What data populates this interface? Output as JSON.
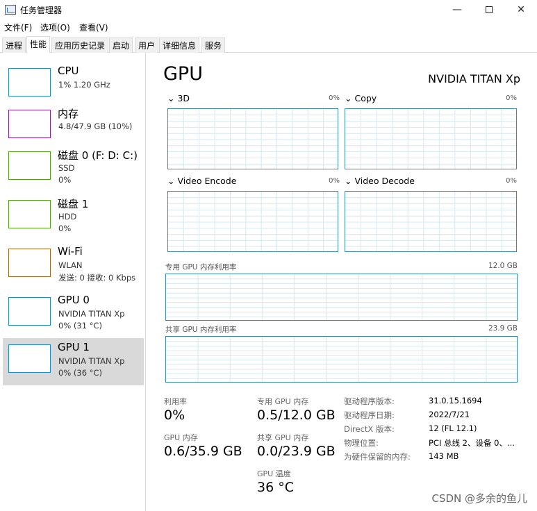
{
  "window": {
    "title": "任务管理器",
    "min": "—",
    "close": "✕"
  },
  "menu": [
    "文件(F)",
    "选项(O)",
    "查看(V)"
  ],
  "tabs": [
    "进程",
    "性能",
    "应用历史记录",
    "启动",
    "用户",
    "详细信息",
    "服务"
  ],
  "active_tab": "性能",
  "sidebar": [
    {
      "title": "CPU",
      "sub": [
        "1% 1.20 GHz"
      ],
      "color": "#1f8bcb"
    },
    {
      "title": "内存",
      "sub": [
        "4.8/47.9 GB (10%)"
      ],
      "color": "#8b1fb0"
    },
    {
      "title": "磁盘 0 (F: D: C:)",
      "sub": [
        "SSD",
        "0%"
      ],
      "color": "#4da516"
    },
    {
      "title": "磁盘 1",
      "sub": [
        "HDD",
        "0%"
      ],
      "color": "#4da516"
    },
    {
      "title": "Wi-Fi",
      "sub": [
        "WLAN",
        "发送: 0 接收: 0 Kbps"
      ],
      "color": "#a7651e"
    },
    {
      "title": "GPU 0",
      "sub": [
        "NVIDIA TITAN Xp",
        "0% (31 °C)"
      ],
      "color": "#1f8bcb"
    },
    {
      "title": "GPU 1",
      "sub": [
        "NVIDIA TITAN Xp",
        "0% (36 °C)"
      ],
      "color": "#1f8bcb",
      "selected": true
    }
  ],
  "main": {
    "title": "GPU",
    "gpu_name": "NVIDIA TITAN Xp",
    "engines": [
      {
        "label": "3D",
        "pct": "0%"
      },
      {
        "label": "Copy",
        "pct": "0%"
      },
      {
        "label": "Video Encode",
        "pct": "0%"
      },
      {
        "label": "Video Decode",
        "pct": "0%"
      }
    ],
    "dedicated_label": "专用 GPU 内存利用率",
    "dedicated_max": "12.0 GB",
    "shared_label": "共享 GPU 内存利用率",
    "shared_max": "23.9 GB",
    "stats": {
      "util_label": "利用率",
      "util_value": "0%",
      "ded_label": "专用 GPU 内存",
      "ded_value": "0.5/12.0 GB",
      "gpumem_label": "GPU 内存",
      "gpumem_value": "0.6/35.9 GB",
      "shared_label": "共享 GPU 内存",
      "shared_value": "0.0/23.9 GB",
      "temp_label": "GPU 温度",
      "temp_value": "36 °C"
    },
    "info": [
      {
        "key": "驱动程序版本:",
        "value": "31.0.15.1694"
      },
      {
        "key": "驱动程序日期:",
        "value": "2022/7/21"
      },
      {
        "key": "DirectX 版本:",
        "value": "12 (FL 12.1)"
      },
      {
        "key": "物理位置:",
        "value": "PCI 总线 2、设备 0、..."
      },
      {
        "key": "为硬件保留的内存:",
        "value": "143 MB"
      }
    ]
  },
  "watermark": "CSDN @多余的鱼儿"
}
